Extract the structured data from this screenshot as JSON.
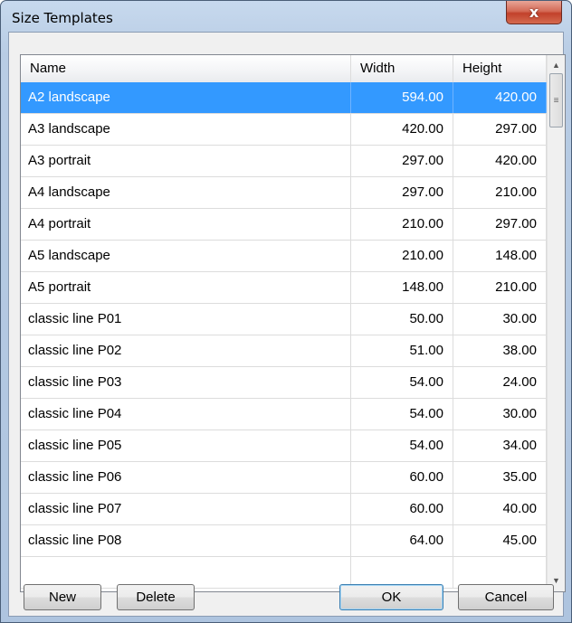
{
  "window": {
    "title": "Size Templates",
    "close_glyph": "x"
  },
  "table": {
    "columns": [
      "Name",
      "Width",
      "Height"
    ],
    "rows": [
      {
        "name": "A2 landscape",
        "width": "594.00",
        "height": "420.00",
        "selected": true
      },
      {
        "name": "A3 landscape",
        "width": "420.00",
        "height": "297.00"
      },
      {
        "name": "A3 portrait",
        "width": "297.00",
        "height": "420.00"
      },
      {
        "name": "A4 landscape",
        "width": "297.00",
        "height": "210.00"
      },
      {
        "name": "A4 portrait",
        "width": "210.00",
        "height": "297.00"
      },
      {
        "name": "A5 landscape",
        "width": "210.00",
        "height": "148.00"
      },
      {
        "name": "A5 portrait",
        "width": "148.00",
        "height": "210.00"
      },
      {
        "name": "classic line P01",
        "width": "50.00",
        "height": "30.00"
      },
      {
        "name": "classic line P02",
        "width": "51.00",
        "height": "38.00"
      },
      {
        "name": "classic line P03",
        "width": "54.00",
        "height": "24.00"
      },
      {
        "name": "classic line P04",
        "width": "54.00",
        "height": "30.00"
      },
      {
        "name": "classic line P05",
        "width": "54.00",
        "height": "34.00"
      },
      {
        "name": "classic line P06",
        "width": "60.00",
        "height": "35.00"
      },
      {
        "name": "classic line P07",
        "width": "60.00",
        "height": "40.00"
      },
      {
        "name": "classic line P08",
        "width": "64.00",
        "height": "45.00"
      },
      {
        "name": "",
        "width": "",
        "height": ""
      }
    ]
  },
  "buttons": {
    "new": "New",
    "delete": "Delete",
    "ok": "OK",
    "cancel": "Cancel"
  },
  "icons": {
    "scroll_up": "scroll-up-arrow-icon",
    "scroll_down": "scroll-down-arrow-icon",
    "grip": "scroll-grip-icon"
  },
  "colors": {
    "selection": "#3399ff",
    "close_button": "#c2412b"
  }
}
